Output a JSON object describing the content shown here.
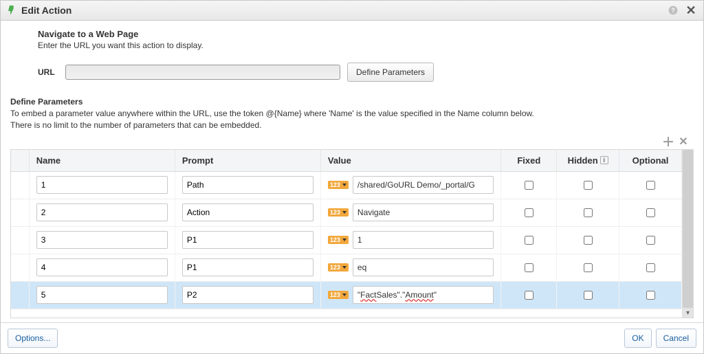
{
  "dialog": {
    "title": "Edit Action"
  },
  "nav": {
    "heading": "Navigate to a Web Page",
    "sub": "Enter the URL you want this action to display."
  },
  "url": {
    "label": "URL",
    "value": "",
    "define_btn": "Define Parameters"
  },
  "params": {
    "heading": "Define Parameters",
    "help1": "To embed a parameter value anywhere within the URL, use the token @{Name} where 'Name' is the value specified in the Name column below.",
    "help2": "There is no limit to the number of parameters that can be embedded."
  },
  "columns": {
    "name": "Name",
    "prompt": "Prompt",
    "value": "Value",
    "fixed": "Fixed",
    "hidden": "Hidden",
    "optional": "Optional"
  },
  "rows": [
    {
      "name": "1",
      "prompt": "Path",
      "type": "123",
      "value_plain": "/shared/GoURL Demo/_portal/G",
      "fixed": false,
      "hidden": false,
      "optional": false,
      "selected": false
    },
    {
      "name": "2",
      "prompt": "Action",
      "type": "123",
      "value_plain": "Navigate",
      "fixed": false,
      "hidden": false,
      "optional": false,
      "selected": false
    },
    {
      "name": "3",
      "prompt": "P1",
      "type": "123",
      "value_plain": "1",
      "fixed": false,
      "hidden": false,
      "optional": false,
      "selected": false
    },
    {
      "name": "4",
      "prompt": "P1",
      "type": "123",
      "value_plain": "eq",
      "fixed": false,
      "hidden": false,
      "optional": false,
      "selected": false
    },
    {
      "name": "5",
      "prompt": "P2",
      "type": "123",
      "value_plain": "\"Fact Sales\".\"Amount\"",
      "fixed": false,
      "hidden": false,
      "optional": false,
      "selected": true,
      "value_rich": [
        {
          "t": "\""
        },
        {
          "t": "Fact",
          "squiggle": true
        },
        {
          "t": " Sales\".\""
        },
        {
          "t": "Amount",
          "squiggle": true
        },
        {
          "t": "\""
        }
      ]
    }
  ],
  "footer": {
    "options": "Options...",
    "ok": "OK",
    "cancel": "Cancel"
  }
}
